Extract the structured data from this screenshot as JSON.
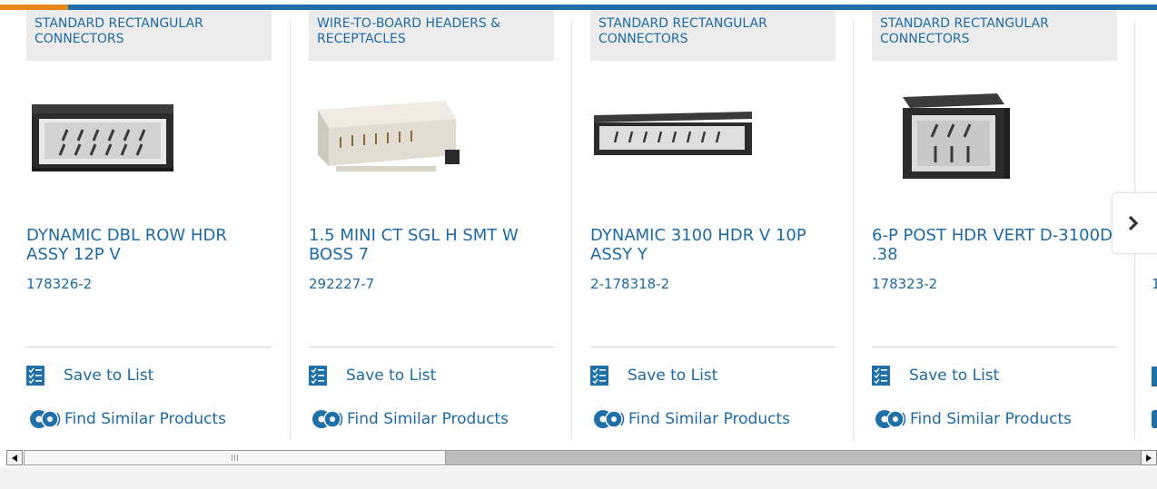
{
  "cards": [
    {
      "category": "STANDARD RECTANGULAR CONNECTORS",
      "name": "DYNAMIC DBL ROW HDR ASSY 12P V",
      "part_number": "178326-2",
      "save_label": "Save to List",
      "find_label": "Find Similar Products"
    },
    {
      "category": "WIRE-TO-BOARD HEADERS & RECEPTACLES",
      "name": "1.5 MINI CT SGL H SMT W BOSS 7",
      "part_number": "292227-7",
      "save_label": "Save to List",
      "find_label": "Find Similar Products"
    },
    {
      "category": "STANDARD RECTANGULAR CONNECTORS",
      "name": "DYNAMIC 3100 HDR V 10P ASSY Y",
      "part_number": "2-178318-2",
      "save_label": "Save to List",
      "find_label": "Find Similar Products"
    },
    {
      "category": "STANDARD RECTANGULAR CONNECTORS",
      "name": "6-P POST HDR VERT D-3100D .38",
      "part_number": "178323-2",
      "save_label": "Save to List",
      "find_label": "Find Similar Products"
    }
  ],
  "partial_card": {
    "part_number": "1"
  },
  "carousel": {
    "next_icon": "chevron-right-icon"
  },
  "scrollbar": {
    "position_fraction": 0.0,
    "visible_fraction": 0.38
  },
  "colors": {
    "accent": "#1f6fa8",
    "highlight": "#e8861a",
    "link": "#1d6aa5"
  }
}
